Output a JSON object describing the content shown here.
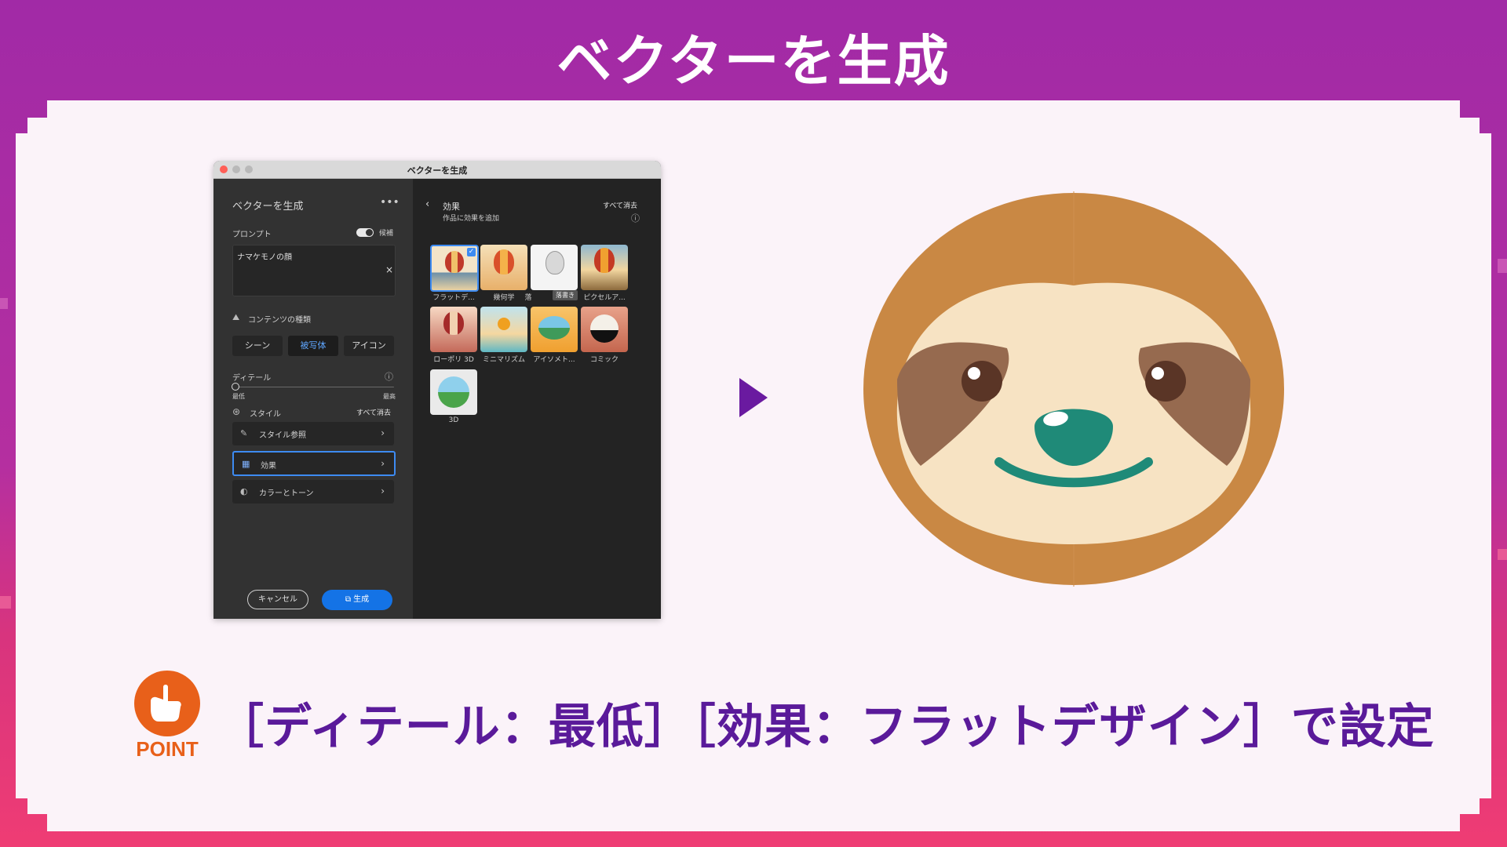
{
  "slide": {
    "title": "ベクターを生成",
    "point_label": "POINT",
    "point_text": "［ディテール：最低］［効果：フラットデザイン］で設定"
  },
  "colors": {
    "banner": "#a12aa6",
    "accent_purple": "#5a1a9a",
    "point_orange": "#e8601a",
    "generate_blue": "#1473e6",
    "sloth_fur": "#c98844",
    "sloth_face": "#f7e3c3",
    "sloth_patch": "#966a4f",
    "sloth_nose": "#1f8a78"
  },
  "window": {
    "title": "ベクターを生成",
    "panel_title": "ベクターを生成",
    "more_icon": "ellipsis-icon",
    "prompt": {
      "label": "プロンプト",
      "toggle_label": "候補",
      "value": "ナマケモノの顔",
      "clear_icon": "close-icon"
    },
    "content_type": {
      "label": "コンテンツの種類",
      "options": [
        "シーン",
        "被写体",
        "アイコン"
      ],
      "selected": "被写体"
    },
    "detail": {
      "label": "ディテール",
      "min_label": "最低",
      "max_label": "最高",
      "value": 0
    },
    "style": {
      "label": "スタイル",
      "clear_all": "すべて消去",
      "rows": [
        "スタイル参照",
        "効果",
        "カラーとトーン"
      ],
      "selected_row": "効果"
    },
    "buttons": {
      "cancel": "キャンセル",
      "generate": "生成"
    },
    "effects": {
      "back_label": "効果",
      "subtitle": "作品に効果を追加",
      "clear_all": "すべて消去",
      "tooltip": "落書き",
      "items": [
        "フラットデ...",
        "幾何学",
        "落",
        "ピクセルア...",
        "ローポリ 3D",
        "ミニマリズム",
        "アイソメト...",
        "コミック",
        "3D"
      ],
      "selected": "フラットデ..."
    }
  }
}
